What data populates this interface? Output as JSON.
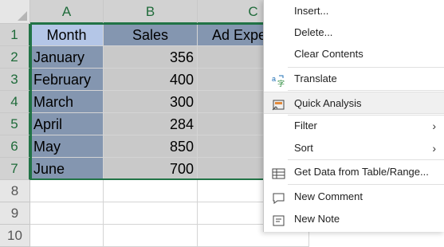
{
  "columns": [
    "A",
    "B",
    "C"
  ],
  "rows": [
    "1",
    "2",
    "3",
    "4",
    "5",
    "6",
    "7",
    "8",
    "9",
    "10"
  ],
  "header_row": {
    "month": "Month",
    "sales": "Sales",
    "ad": "Ad Expe"
  },
  "data_rows": [
    {
      "month": "January",
      "sales": "356"
    },
    {
      "month": "February",
      "sales": "400"
    },
    {
      "month": "March",
      "sales": "300"
    },
    {
      "month": "April",
      "sales": "284"
    },
    {
      "month": "May",
      "sales": "850"
    },
    {
      "month": "June",
      "sales": "700"
    }
  ],
  "menu": {
    "insert": "Insert...",
    "delete": "Delete...",
    "clear": "Clear Contents",
    "translate": "Translate",
    "quick_analysis": "Quick Analysis",
    "filter": "Filter",
    "sort": "Sort",
    "get_data": "Get Data from Table/Range...",
    "new_comment": "New Comment",
    "new_note": "New Note"
  },
  "colors": {
    "accent": "#217346",
    "month_fill": "#8496b0",
    "sales_fill": "#c9c9c9",
    "header_fill": "#b4c6e7"
  }
}
